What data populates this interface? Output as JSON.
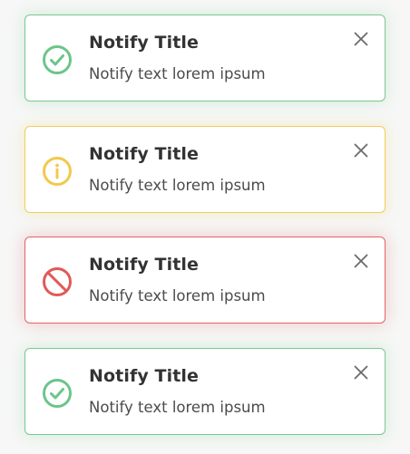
{
  "colors": {
    "success": "#6cc58a",
    "warning": "#f2c94c",
    "error": "#e05a5a",
    "close": "#6b6b6b"
  },
  "notifications": [
    {
      "type": "success",
      "icon": "check-circle-icon",
      "title": "Notify Title",
      "text": "Notify text lorem ipsum"
    },
    {
      "type": "warning",
      "icon": "info-circle-icon",
      "title": "Notify Title",
      "text": "Notify text lorem ipsum"
    },
    {
      "type": "error",
      "icon": "prohibited-circle-icon",
      "title": "Notify Title",
      "text": "Notify text lorem ipsum"
    },
    {
      "type": "success",
      "icon": "check-circle-icon",
      "title": "Notify Title",
      "text": "Notify text lorem ipsum"
    }
  ]
}
